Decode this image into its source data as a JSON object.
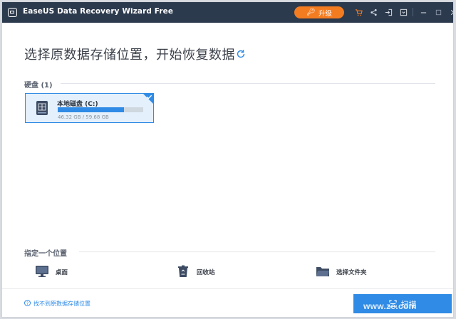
{
  "window": {
    "title": "EaseUS Data Recovery Wizard Free"
  },
  "toolbar": {
    "upgrade_label": "升级",
    "icons": [
      "cart-icon",
      "share-icon",
      "login-icon",
      "menu-icon",
      "minimize-icon",
      "maximize-icon",
      "close-icon"
    ]
  },
  "main": {
    "headline": "选择原数据存储位置，开始恢复数据",
    "disks_section": {
      "label": "硬盘 (1)",
      "disks": [
        {
          "name": "本地磁盘 (C:)",
          "size_text": "46.32 GB / 59.68 GB",
          "used_fraction": 0.776,
          "selected": true
        }
      ]
    },
    "location_section": {
      "label": "指定一个位置",
      "items": [
        {
          "label": "桌面",
          "icon": "desktop-icon"
        },
        {
          "label": "回收站",
          "icon": "recycle-bin-icon"
        },
        {
          "label": "选择文件夹",
          "icon": "folder-icon"
        }
      ]
    }
  },
  "footer": {
    "help_link": "找不到原数据存储位置",
    "scan_label": "扫描"
  },
  "watermark": "www.ze.com",
  "colors": {
    "titlebar": "#2c3a4d",
    "accent": "#2f8be5",
    "upgrade": "#f47c20"
  }
}
